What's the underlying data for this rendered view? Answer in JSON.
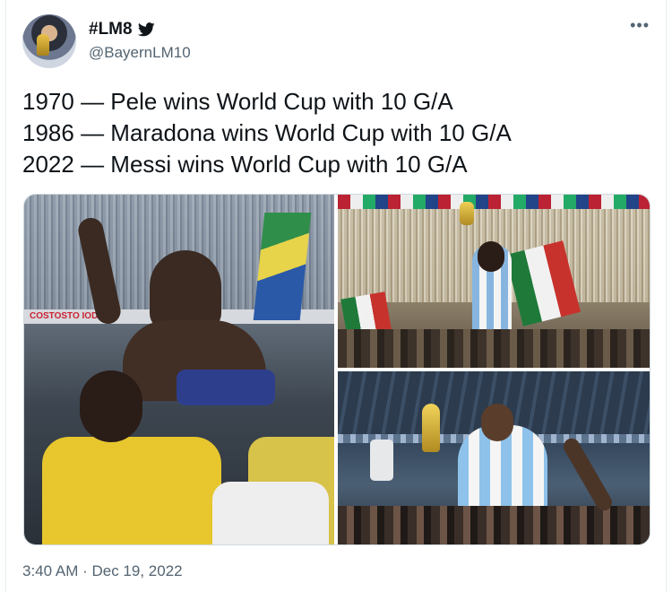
{
  "user": {
    "display_name": "#LM8",
    "handle": "@BayernLM10",
    "verified_icon": "twitter-bird-icon",
    "avatar": "avatar-trophy-photo"
  },
  "more_icon": "•••",
  "tweet": {
    "lines": [
      "1970 — Pele wins World Cup with 10 G/A",
      "1986 — Maradona wins World Cup with 10 G/A",
      "2022 — Messi wins World Cup with 10 G/A"
    ]
  },
  "media": {
    "photos": [
      "photo-pele-1970",
      "photo-maradona-1986",
      "photo-messi-2022"
    ],
    "banner_text": "COSTOSTO IODEX"
  },
  "timestamp": "3:40 AM · Dec 19, 2022",
  "colors": {
    "text": "#0f1419",
    "muted": "#536471",
    "twitter_blue": "#1d9bf0"
  }
}
